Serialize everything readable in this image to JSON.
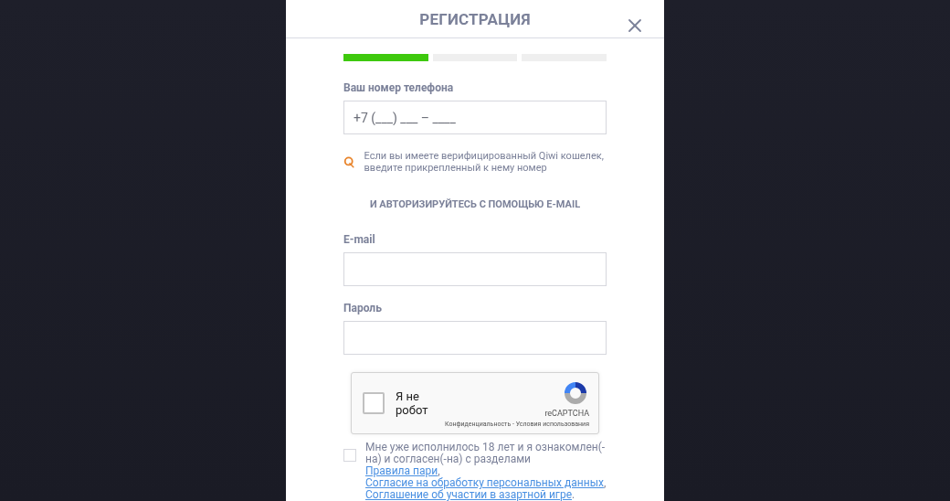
{
  "modal": {
    "title": "РЕГИСТРАЦИЯ",
    "steps": [
      {
        "done": true
      },
      {
        "done": false
      },
      {
        "done": false
      }
    ],
    "phone": {
      "label": "Ваш номер телефона",
      "placeholder": "+7 (___) ___ – ____"
    },
    "qiwi_note": "Если вы имеете верифицированный Qiwi кошелек, введите прикрепленный к нему номер",
    "email_divider": "И АВТОРИЗИРУЙТЕСЬ С ПОМОЩЬЮ E-MAIL",
    "email": {
      "label": "E-mail"
    },
    "password": {
      "label": "Пароль"
    },
    "captcha": {
      "label": "Я не робот",
      "checked": false,
      "brand": "reCAPTCHA",
      "footer": "Конфиденциальность - Условия использования"
    },
    "consent": {
      "checked": false,
      "parts": [
        {
          "kind": "text",
          "text": "Мне уже исполнилось 18 лет и я ознакомлен(-на) и согласен(-на) с разделами "
        },
        {
          "kind": "link",
          "text": "Правила пари"
        },
        {
          "kind": "text",
          "text": ", "
        },
        {
          "kind": "link",
          "text": "Согласие на обработку персональных данных"
        },
        {
          "kind": "text",
          "text": ", "
        },
        {
          "kind": "link",
          "text": "Соглашение об участии в азартной игре"
        },
        {
          "kind": "text",
          "text": "."
        }
      ]
    }
  }
}
